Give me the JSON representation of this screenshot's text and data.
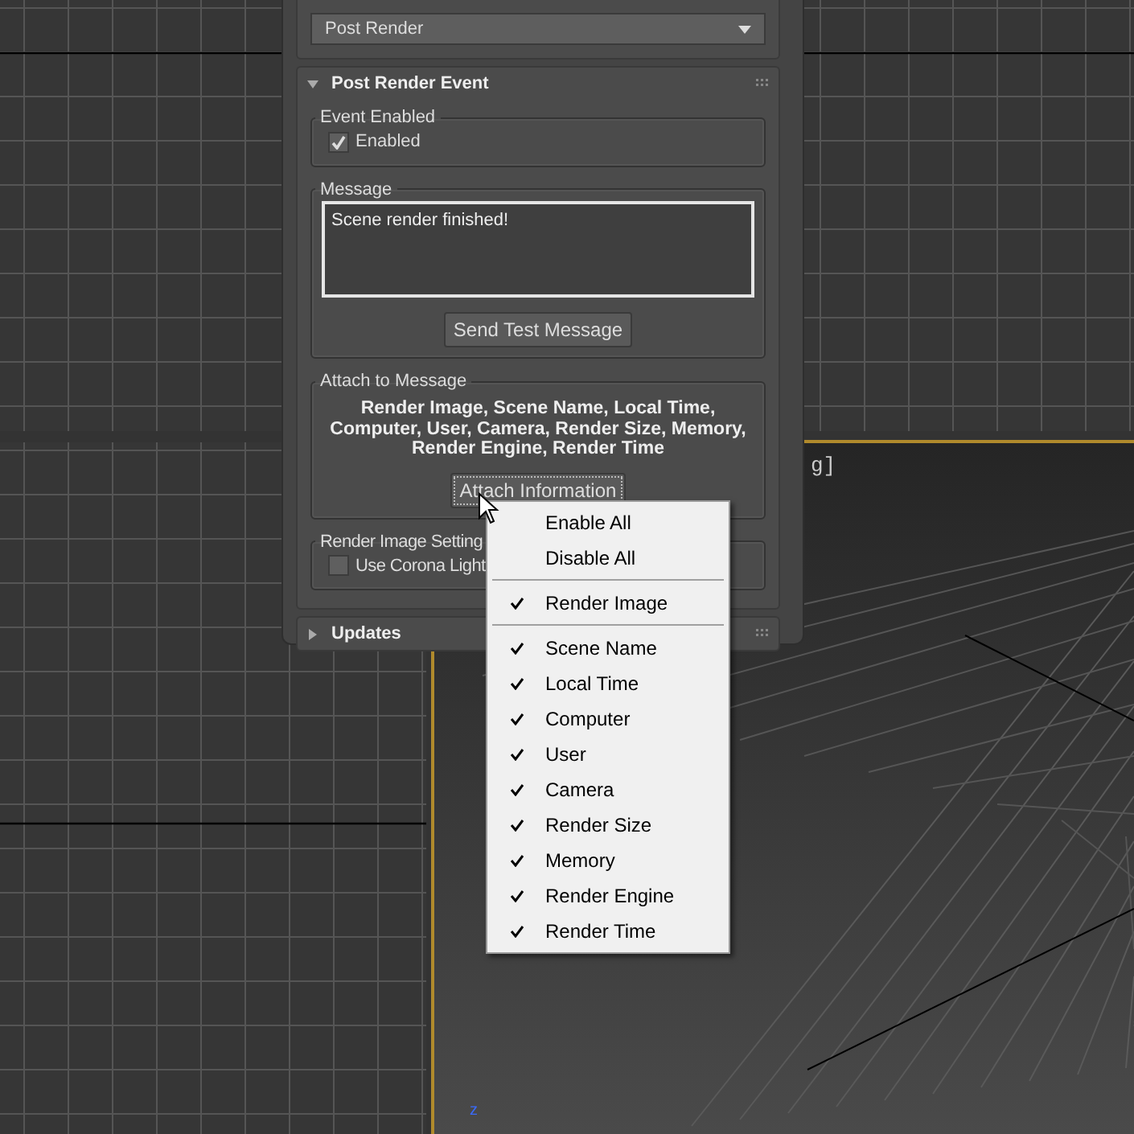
{
  "viewport": {
    "label": "g]",
    "axis": "z"
  },
  "panel": {
    "dropdown": {
      "value": "Post Render"
    },
    "post_render_event": {
      "title": "Post Render Event",
      "expanded": true,
      "event_enabled": {
        "label": "Event Enabled",
        "checkbox": {
          "label": "Enabled",
          "checked": true
        }
      },
      "message": {
        "label": "Message",
        "value": "Scene render finished!",
        "button": "Send Test Message"
      },
      "attach": {
        "label": "Attach to Message",
        "summary": "Render Image, Scene Name, Local Time, Computer, User, Camera, Render Size, Memory, Render Engine, Render Time",
        "button": "Attach Information"
      },
      "render_image_settings": {
        "label": "Render Image Setting",
        "checkbox": {
          "label": "Use Corona Light",
          "checked": false
        }
      }
    },
    "updates": {
      "title": "Updates",
      "expanded": false
    }
  },
  "context_menu": {
    "items": [
      {
        "kind": "item",
        "label": "Enable All",
        "checked": false
      },
      {
        "kind": "item",
        "label": "Disable All",
        "checked": false
      },
      {
        "kind": "separator"
      },
      {
        "kind": "item",
        "label": "Render Image",
        "checked": true
      },
      {
        "kind": "separator"
      },
      {
        "kind": "item",
        "label": "Scene Name",
        "checked": true
      },
      {
        "kind": "item",
        "label": "Local Time",
        "checked": true
      },
      {
        "kind": "item",
        "label": "Computer",
        "checked": true
      },
      {
        "kind": "item",
        "label": "User",
        "checked": true
      },
      {
        "kind": "item",
        "label": "Camera",
        "checked": true
      },
      {
        "kind": "item",
        "label": "Render Size",
        "checked": true
      },
      {
        "kind": "item",
        "label": "Memory",
        "checked": true
      },
      {
        "kind": "item",
        "label": "Render Engine",
        "checked": true
      },
      {
        "kind": "item",
        "label": "Render Time",
        "checked": true
      }
    ]
  }
}
